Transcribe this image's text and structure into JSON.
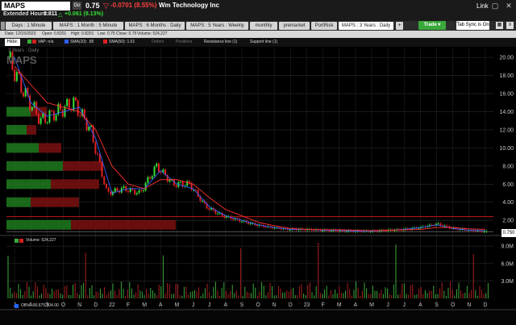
{
  "header": {
    "symbol": "MAPS",
    "go_label": "Go",
    "last_price": "0.75",
    "change_arrow": "▽",
    "change": "-0.0701 (8.55%)",
    "company_name": "Wm Technology Inc",
    "link_label": "Link",
    "extended_label": "Extended Hours:",
    "extended_price": "0.811",
    "extended_arrow": "△",
    "extended_change": "+0.061 (8.13%)"
  },
  "tabs": [
    {
      "label": "Days : 1 Minute"
    },
    {
      "label": "MAPS : 1 Month : 5 Minute"
    },
    {
      "label": "MAPS : 6 Months : Daily"
    },
    {
      "label": "MAPS : 5 Years : Weekly"
    },
    {
      "label": "monthly"
    },
    {
      "label": "premarket"
    },
    {
      "label": "PortRisk"
    },
    {
      "label": "MAPS : 3 Years : Daily"
    }
  ],
  "trade_button": "Trade ▾",
  "tab_sync": "Tab Sync is On",
  "info_line": {
    "date": "Date: 12/15/2023",
    "open": "Open: 0.8201",
    "high": "High: 0.8201",
    "low": "Low: 0.75",
    "close": "Close: 0.75",
    "volume": "Volume: 524,227"
  },
  "toolbar": {
    "hide_label": "Hide:",
    "vap": "VAP: n/a",
    "sma10": "SMA(10): .85",
    "sma50": "SMA(50): 1.01",
    "orders": "Orders",
    "positions": "Positions",
    "resistance": "Resistance line (1)",
    "support": "Support line (1)"
  },
  "colors": {
    "sma10": "#3060ff",
    "sma50": "#ff3030",
    "up": "#36e036",
    "down": "#e02020",
    "volume": "#888888",
    "obv": "#2266ff"
  },
  "chart_data": {
    "type": "line",
    "timeframe_label": "3 Years : Daily",
    "watermark": "MAPS",
    "x_ticks": [
      "J",
      "A",
      "S",
      "O",
      "N",
      "D",
      "22",
      "F",
      "M",
      "A",
      "M",
      "J",
      "J",
      "A",
      "S",
      "O",
      "N",
      "D",
      "23",
      "F",
      "M",
      "A",
      "M",
      "J",
      "J",
      "A",
      "S",
      "O",
      "N",
      "D"
    ],
    "y_ticks": [
      "20.00",
      "18.00",
      "16.00",
      "14.00",
      "12.00",
      "10.00",
      "8.00",
      "6.00",
      "4.00",
      "2.00"
    ],
    "ylim": [
      0.5,
      21
    ],
    "last_price_label": "0.750",
    "series": [
      {
        "name": "SMA(10)",
        "values": [
          20,
          15,
          13.5,
          14,
          14.5,
          11,
          5,
          5.5,
          5.5,
          7.5,
          6,
          5.5,
          3.5,
          2.5,
          2,
          1.5,
          1.2,
          1.0,
          1.0,
          0.9,
          0.9,
          0.8,
          0.8,
          0.9,
          1.0,
          1.2,
          1.5,
          1.1,
          0.9,
          0.85
        ]
      },
      {
        "name": "SMA(50)",
        "values": [
          19,
          17,
          15,
          14.5,
          14,
          12,
          8,
          6,
          5.5,
          6.5,
          6.5,
          6,
          4.5,
          3.2,
          2.5,
          1.8,
          1.4,
          1.1,
          1.0,
          0.95,
          0.95,
          0.9,
          0.85,
          0.9,
          0.95,
          1.0,
          1.2,
          1.2,
          1.05,
          1.01
        ]
      }
    ],
    "close_values": [
      20,
      16,
      13,
      14,
      15,
      12,
      5,
      5.5,
      5,
      8,
      6,
      6,
      3.5,
      2.5,
      2,
      1.5,
      1.2,
      1.0,
      1.0,
      0.9,
      0.85,
      0.8,
      0.8,
      0.9,
      1.0,
      1.2,
      1.6,
      1.1,
      0.9,
      0.75
    ],
    "support_level": 0.75,
    "resistance_level": 2.4,
    "volume": {
      "label": "Volume: 524,227",
      "y_ticks": [
        "9.0M",
        "6.0M",
        "3.0M"
      ],
      "ylim": [
        0,
        10
      ]
    },
    "obv": {
      "label": "OBV: -90,675,704.00"
    }
  }
}
